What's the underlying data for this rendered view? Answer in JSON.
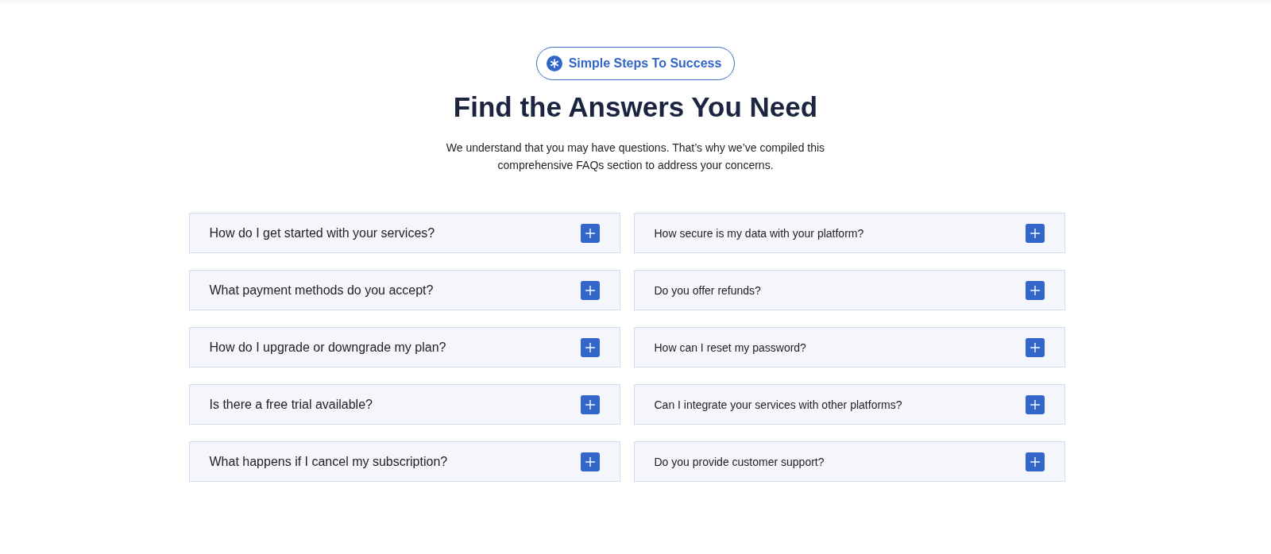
{
  "badge": {
    "label": "Simple Steps To Success"
  },
  "heading": "Find the Answers You Need",
  "intro": "We understand that you may have questions. That’s why we’ve compiled this comprehensive FAQs section to address your concerns.",
  "columns": [
    {
      "kind": "large",
      "items": [
        {
          "question": "How do I get started with your services?",
          "expanded": false
        },
        {
          "question": "What payment methods do you accept?",
          "expanded": false
        },
        {
          "question": "How do I upgrade or downgrade my plan?",
          "expanded": false
        },
        {
          "question": "Is there a free trial available?",
          "expanded": false
        },
        {
          "question": "What happens if I cancel my subscription?",
          "expanded": false
        }
      ]
    },
    {
      "kind": "small",
      "items": [
        {
          "question": "How secure is my data with your platform?",
          "expanded": false
        },
        {
          "question": "Do you offer refunds?",
          "expanded": false
        },
        {
          "question": "How can I reset my password?",
          "expanded": false
        },
        {
          "question": "Can I integrate your services with other platforms?",
          "expanded": false
        },
        {
          "question": "Do you provide customer support?",
          "expanded": false
        }
      ]
    }
  ]
}
